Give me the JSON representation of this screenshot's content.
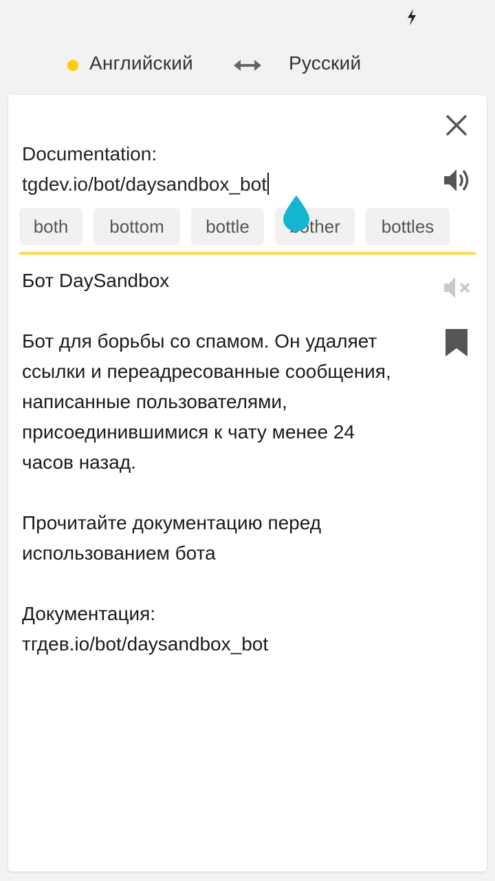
{
  "languages": {
    "source": "Английский",
    "target": "Русский",
    "accent_color": "#ffcc00"
  },
  "input": {
    "line1": "Documentation:",
    "line2": "tgdev.io/bot/daysandbox_bot"
  },
  "suggestions": [
    "both",
    "bottom",
    "bottle",
    "bother",
    "bottles"
  ],
  "output": {
    "title": "Бот DaySandbox",
    "para1": [
      "Бот для борьбы со спамом. Он удаляет",
      "ссылки и переадресованные сообщения,",
      "написанные пользователями,",
      "присоединившимися к чату менее 24",
      "часов назад."
    ],
    "para2": [
      "Прочитайте документацию перед",
      "использованием бота"
    ],
    "para3": [
      "Документация:",
      "тгдев.io/bot/daysandbox_bot"
    ]
  },
  "icons": {
    "status": "bolt-icon",
    "swap": "swap-arrows-icon",
    "close": "close-icon",
    "speaker": "speaker-icon",
    "mute": "speaker-muted-icon",
    "bookmark": "bookmark-icon",
    "cursor_handle": "text-cursor-handle-icon"
  },
  "colors": {
    "divider": "#ffdb4d",
    "cursor_handle": "#13b5d1"
  }
}
